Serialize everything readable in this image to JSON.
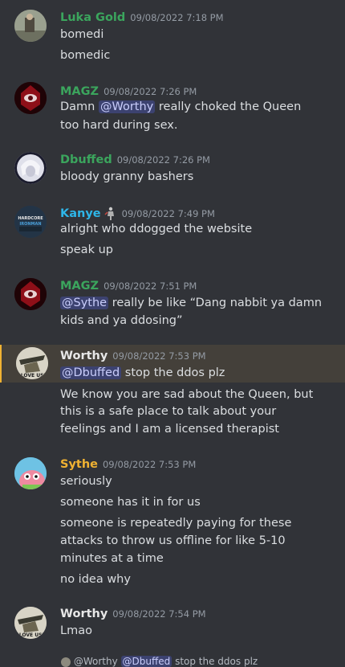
{
  "colors": {
    "background": "#313338",
    "luka": "#3ba55d",
    "magz": "#3ba55d",
    "dbuffed": "#3ba55d",
    "kanye": "#2eb6e8",
    "worthy": "#e7e7e7",
    "sythe": "#f0b232",
    "timestamp": "#949ba4",
    "mention_bg": "#3c4270",
    "highlight_border": "#f0b232"
  },
  "messages": [
    {
      "username": "Luka Gold",
      "timestamp": "09/08/2022 7:18 PM",
      "lines": [
        "bomedi",
        "bomedic"
      ]
    },
    {
      "username": "MAGZ",
      "timestamp": "09/08/2022 7:26 PM",
      "l1_pre": "Damn ",
      "l1_mention": "@Worthy",
      "l1_post": " really choked the Queen",
      "l2": "too hard during sex."
    },
    {
      "username": "Dbuffed",
      "timestamp": "09/08/2022 7:26 PM",
      "lines": [
        "bloody granny  bashers"
      ]
    },
    {
      "username": "Kanye",
      "role_icon": "figure-icon",
      "timestamp": "09/08/2022 7:49 PM",
      "avatar_text": [
        "HARDCORE",
        "IRONMAN"
      ],
      "lines": [
        "alright who ddogged the website",
        "speak up"
      ]
    },
    {
      "username": "MAGZ",
      "timestamp": "09/08/2022 7:51 PM",
      "l1_mention": "@Sythe",
      "l1_post": " really be like “Dang nabbit ya damn",
      "l2": "kids and ya ddosing”"
    },
    {
      "username": "Worthy",
      "timestamp": "09/08/2022 7:53 PM",
      "avatar_text": "I LOVE USE",
      "l1_mention": "@Dbuffed",
      "l1_post": " stop the ddos plz",
      "lines": [
        "We know you are sad about the Queen, but",
        "this is a safe place to talk about your",
        "feelings and I am a licensed therapist"
      ]
    },
    {
      "username": "Sythe",
      "timestamp": "09/08/2022 7:53 PM",
      "lines": [
        "seriously",
        "someone has it in for us",
        "someone is repeatedly paying for these",
        "attacks to throw us offline for like 5-10",
        "minutes at a time",
        "no idea why"
      ]
    },
    {
      "username": "Worthy",
      "timestamp": "09/08/2022 7:54 PM",
      "avatar_text": "I LOVE USE",
      "lines": [
        "Lmao"
      ]
    }
  ],
  "partial_reply": {
    "user": "@Worthy",
    "mention": "@Dbuffed",
    "text": " stop the ddos plz"
  }
}
